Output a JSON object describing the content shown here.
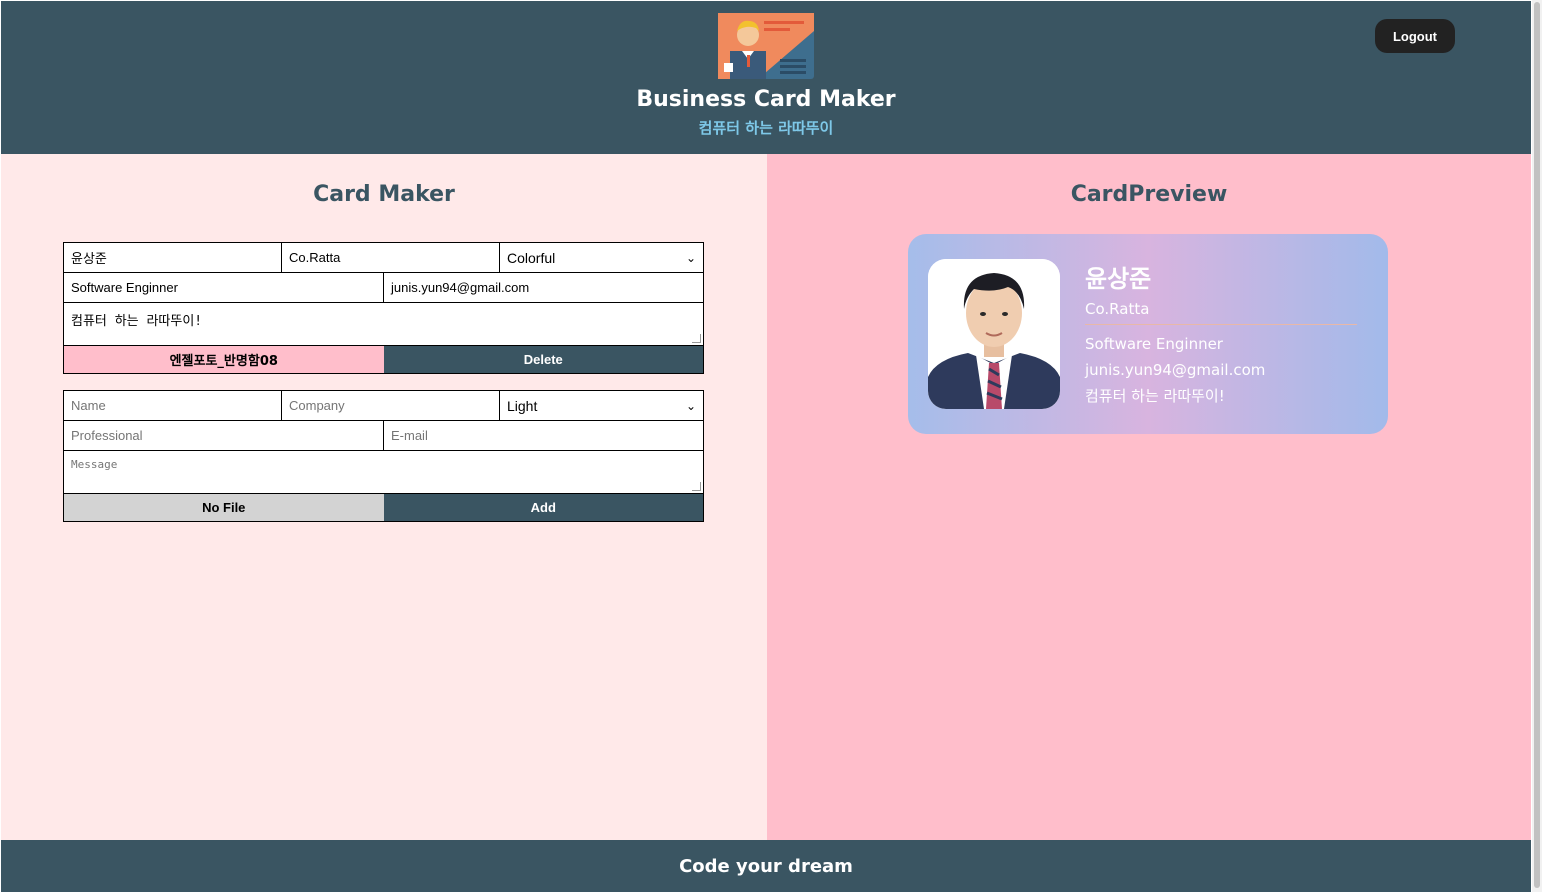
{
  "header": {
    "title": "Business Card Maker",
    "subtitle": "컴퓨터 하는 라따뚜이",
    "logout_label": "Logout"
  },
  "maker": {
    "title": "Card Maker",
    "card_form": {
      "name": "윤상준",
      "company": "Co.Ratta",
      "theme": "Colorful",
      "title": "Software Enginner",
      "email": "junis.yun94@gmail.com",
      "message": "컴퓨터 하는 라따뚜이!",
      "file_label": "엔젤포토_반명함08",
      "delete_label": "Delete"
    },
    "add_form": {
      "name_placeholder": "Name",
      "company_placeholder": "Company",
      "theme": "Light",
      "title_placeholder": "Professional",
      "email_placeholder": "E-mail",
      "message_placeholder": "Message",
      "file_label": "No File",
      "add_label": "Add"
    }
  },
  "preview": {
    "title": "CardPreview",
    "card": {
      "name": "윤상준",
      "company": "Co.Ratta",
      "title": "Software Enginner",
      "email": "junis.yun94@gmail.com",
      "message": "컴퓨터 하는 라따뚜이!"
    }
  },
  "footer": {
    "text": "Code your dream"
  },
  "colors": {
    "header_bg": "#3a5562",
    "maker_bg": "#ffe9e9",
    "preview_bg": "#ffbecb",
    "subtitle": "#7ec8e8",
    "logout_bg": "#222222"
  }
}
